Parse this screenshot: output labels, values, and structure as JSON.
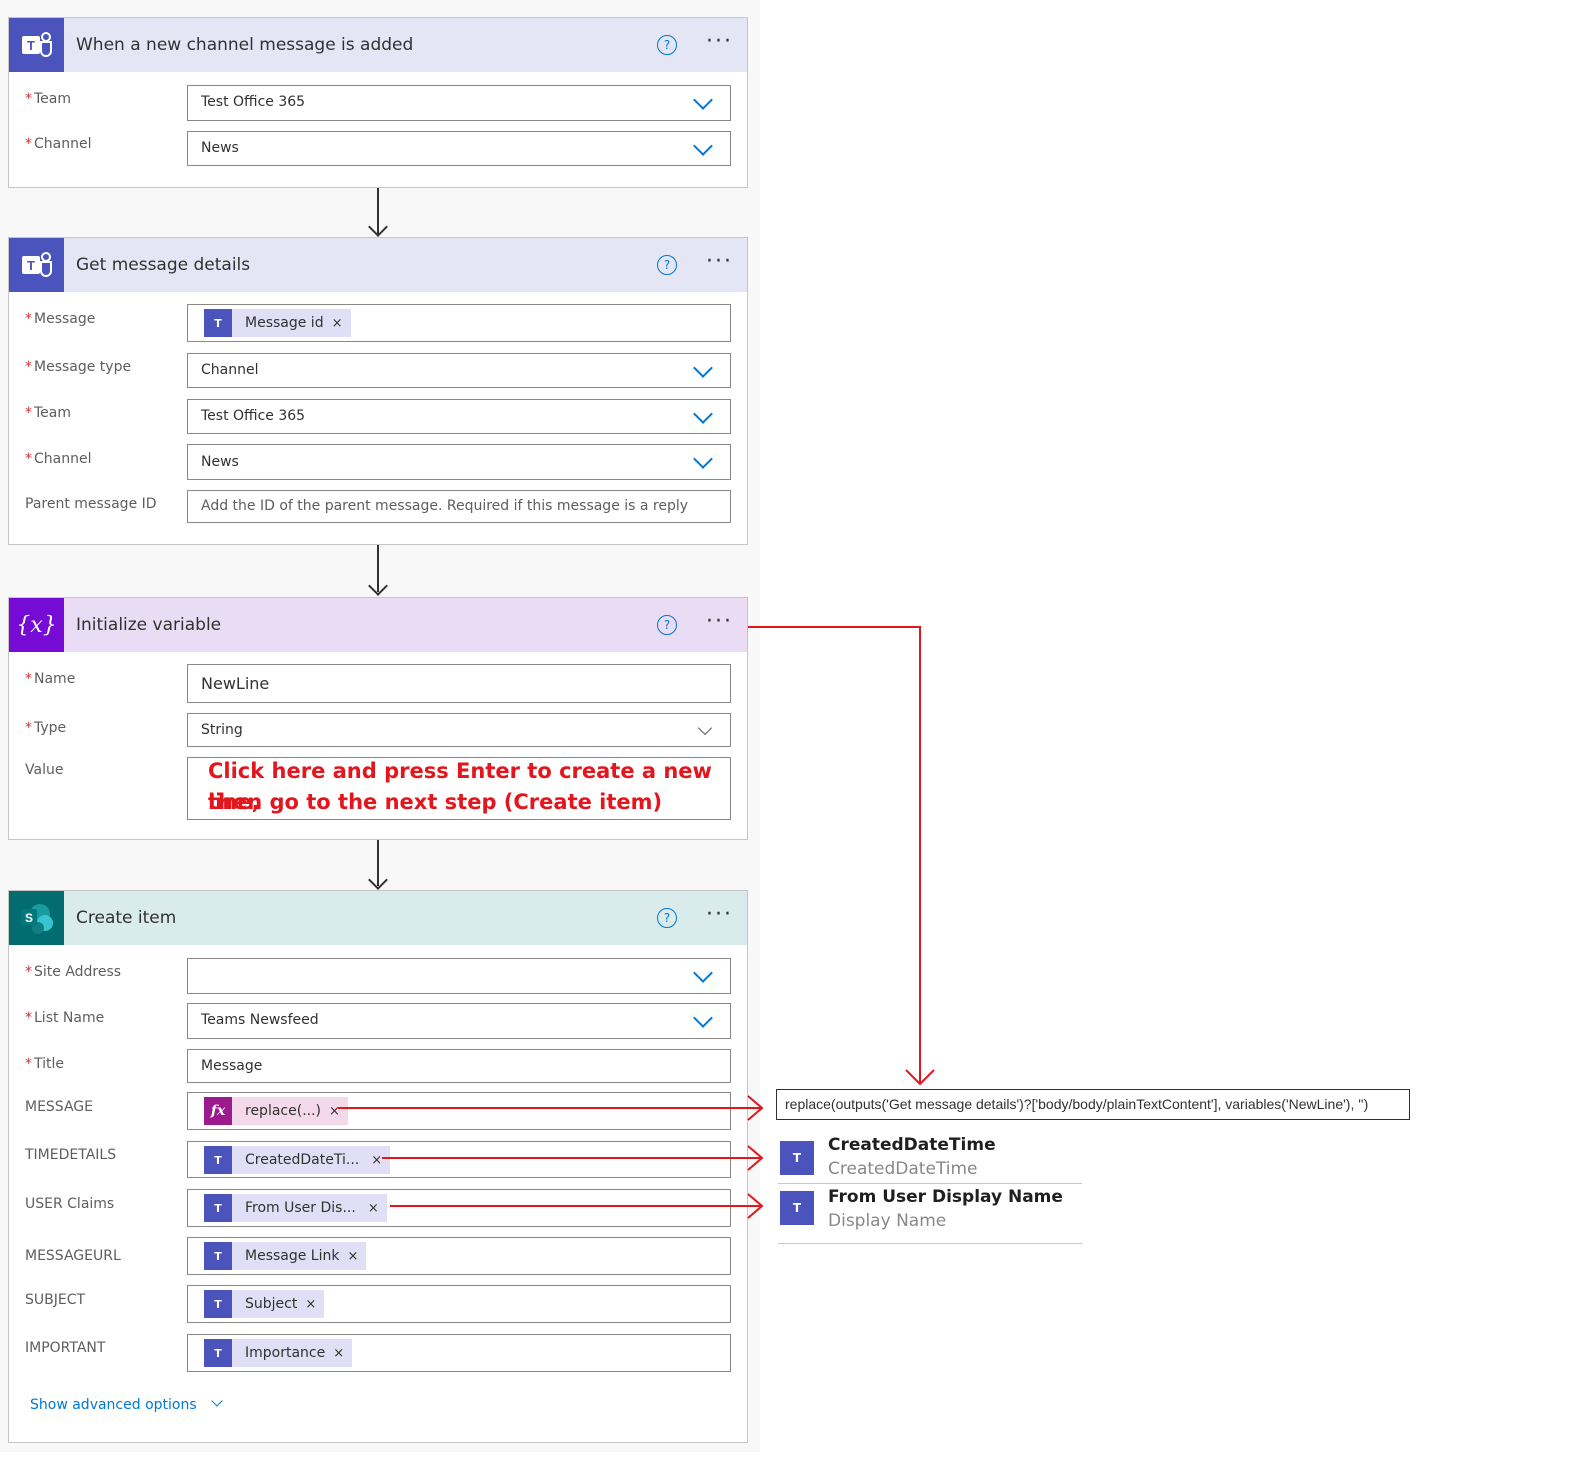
{
  "trigger": {
    "title": "When a new channel message is added",
    "help": "?",
    "more": "···",
    "team_label": "Team",
    "team_value": "Test Office 365",
    "channel_label": "Channel",
    "channel_value": "News"
  },
  "get_details": {
    "title": "Get message details",
    "help": "?",
    "more": "···",
    "message_label": "Message",
    "message_token": "Message id",
    "message_type_label": "Message type",
    "message_type_value": "Channel",
    "team_label": "Team",
    "team_value": "Test Office 365",
    "channel_label": "Channel",
    "channel_value": "News",
    "parent_label": "Parent message ID",
    "parent_placeholder": "Add the ID of the parent message. Required if this message is a reply"
  },
  "init_variable": {
    "title": "Initialize variable",
    "icon_text": "{x}",
    "help": "?",
    "more": "···",
    "name_label": "Name",
    "name_value": "NewLine",
    "type_label": "Type",
    "type_value": "String",
    "value_label": "Value",
    "value_note_line1": "Click here and press Enter to create a new line,",
    "value_note_line2": "then go to the next step (Create item)"
  },
  "create_item": {
    "title": "Create item",
    "help": "?",
    "more": "···",
    "site_label": "Site Address",
    "site_value": "",
    "list_label": "List Name",
    "list_value": "Teams Newsfeed",
    "title_label": "Title",
    "title_value": "Message",
    "message_label": "MESSAGE",
    "message_token": "replace(...)",
    "timedetails_label": "TIMEDETAILS",
    "timedetails_token": "CreatedDateTi...",
    "user_label": "USER Claims",
    "user_token": "From User Dis...",
    "messageurl_label": "MESSAGEURL",
    "messageurl_token": "Message Link",
    "subject_label": "SUBJECT",
    "subject_token": "Subject",
    "important_label": "IMPORTANT",
    "important_token": "Importance",
    "advanced_link": "Show advanced options"
  },
  "required_mark": "*",
  "token_close": "×",
  "expression_popup": "replace(outputs('Get message details')?['body/body/plainTextContent'], variables('NewLine'), '')",
  "dynamic_items": [
    {
      "title": "CreatedDateTime",
      "subtitle": "CreatedDateTime"
    },
    {
      "title": "From User Display Name",
      "subtitle": "Display Name"
    }
  ],
  "colors": {
    "teams_purple": "#4b53bc",
    "variable_purple": "#770bd6",
    "sharepoint_teal": "#036c70",
    "annotation_red": "#e3161e",
    "link_blue": "#0078d4"
  }
}
